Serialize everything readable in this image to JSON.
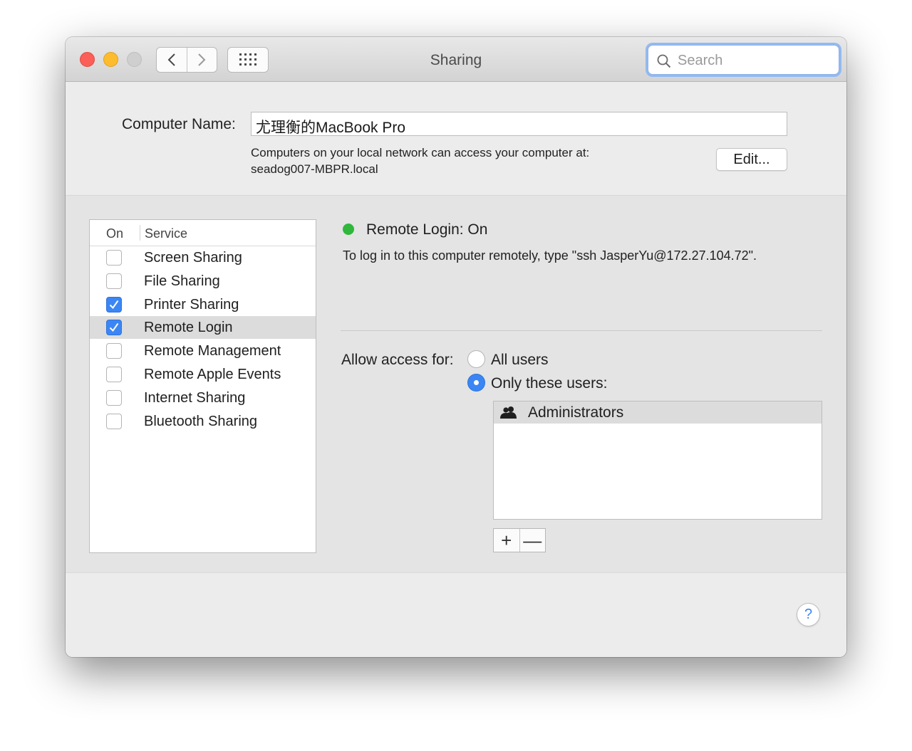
{
  "window": {
    "title": "Sharing"
  },
  "search": {
    "placeholder": "Search"
  },
  "computer_name": {
    "label": "Computer Name:",
    "value": "尤理衡的MacBook Pro",
    "note_line1": "Computers on your local network can access your computer at:",
    "note_line2": "seadog007-MBPR.local",
    "edit_label": "Edit..."
  },
  "services": {
    "header_on": "On",
    "header_service": "Service",
    "items": [
      {
        "label": "Screen Sharing",
        "checked": false,
        "selected": false
      },
      {
        "label": "File Sharing",
        "checked": false,
        "selected": false
      },
      {
        "label": "Printer Sharing",
        "checked": true,
        "selected": false
      },
      {
        "label": "Remote Login",
        "checked": true,
        "selected": true
      },
      {
        "label": "Remote Management",
        "checked": false,
        "selected": false
      },
      {
        "label": "Remote Apple Events",
        "checked": false,
        "selected": false
      },
      {
        "label": "Internet Sharing",
        "checked": false,
        "selected": false
      },
      {
        "label": "Bluetooth Sharing",
        "checked": false,
        "selected": false
      }
    ]
  },
  "detail": {
    "status": "Remote Login: On",
    "status_color": "#2fb83b",
    "description": "To log in to this computer remotely, type \"ssh JasperYu@172.27.104.72\".",
    "access_label": "Allow access for:",
    "option_all": "All users",
    "option_only": "Only these users:",
    "selected_option": "only",
    "users": [
      {
        "name": "Administrators",
        "icon": "group-icon"
      }
    ],
    "add_label": "+",
    "remove_label": "—"
  },
  "help_label": "?",
  "colors": {
    "accent": "#3b86f4",
    "close": "#fc5f57",
    "minimize": "#fdbc2e",
    "zoom": "#cfcfcf"
  }
}
